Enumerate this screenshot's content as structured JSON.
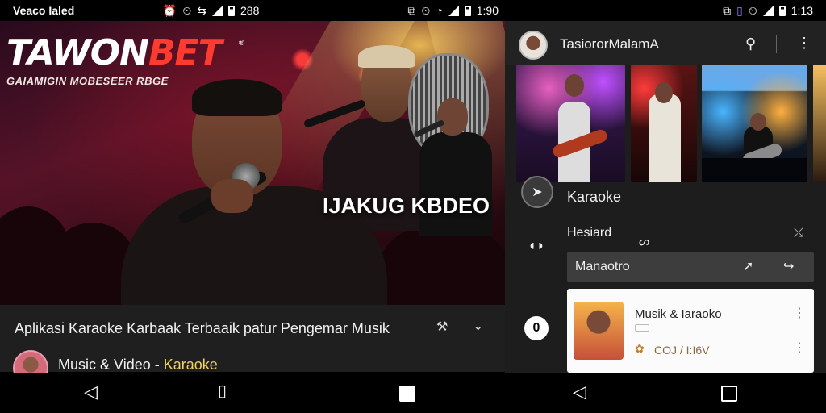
{
  "left_status": {
    "carrier": "Veaco Ialed",
    "icons": [
      "alarm-icon",
      "alarm-icon",
      "network-icon",
      "signal-icon",
      "battery-icon"
    ],
    "value": "288"
  },
  "right_status": {
    "icons": [
      "nfc-icon",
      "alarm-icon",
      "wifi-icon",
      "signal-icon",
      "battery-icon"
    ],
    "time_left_edge": "1:90",
    "time": "1:13"
  },
  "hero": {
    "brand_part1": "TAWON",
    "brand_part2": "BET",
    "brand_mark": "®",
    "tagline": "GAIAMIGIN MOBESEER RBGE",
    "overlay_title": "IJAKUG KBDEO"
  },
  "meta": {
    "title": "Aplikasi Karaoke Karbaak Terbaaik patur Pengemar Musik",
    "category": "Music & Video",
    "separator": " - ",
    "genre": "Karaoke",
    "tool_icon": "wrench-icon",
    "expand_icon": "chevron-down-icon"
  },
  "right_header": {
    "channel_name": "TasiororMalamA",
    "search_icon": "search-icon",
    "more_icon": "more-vertical-icon"
  },
  "right_list": {
    "play_label": "Karaoke",
    "section_label": "Hesiard",
    "section_mark": "ᔕ",
    "pill_label": "Manaotro",
    "card": {
      "title": "Musik & Iaraoko",
      "stat": "COJ / I:I6V"
    }
  },
  "colors": {
    "brand_red": "#ff3b30",
    "accent_yellow": "#f2d25a",
    "panel_dark": "#1d1d1d"
  }
}
